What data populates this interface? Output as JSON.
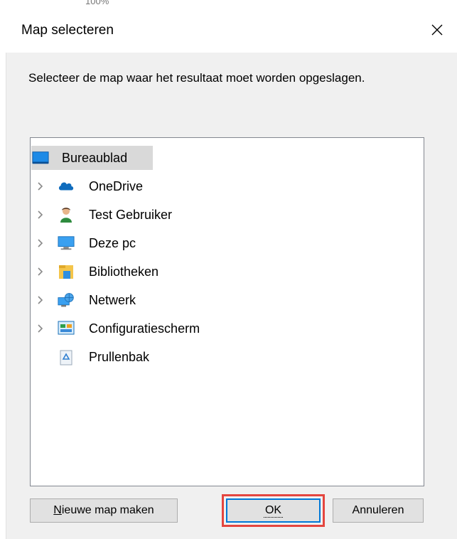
{
  "background": {
    "peek_text": "100%"
  },
  "dialog": {
    "title": "Map selecteren",
    "instruction": "Selecteer de map waar het resultaat moet worden opgeslagen."
  },
  "tree": {
    "root": {
      "label": "Bureaublad",
      "icon": "desktop-icon",
      "selected": true
    },
    "items": [
      {
        "label": "OneDrive",
        "icon": "onedrive-icon",
        "expandable": true
      },
      {
        "label": "Test Gebruiker",
        "icon": "user-icon",
        "expandable": true
      },
      {
        "label": "Deze pc",
        "icon": "computer-icon",
        "expandable": true
      },
      {
        "label": "Bibliotheken",
        "icon": "libraries-icon",
        "expandable": true
      },
      {
        "label": "Netwerk",
        "icon": "network-icon",
        "expandable": true
      },
      {
        "label": "Configuratiescherm",
        "icon": "control-panel-icon",
        "expandable": true
      },
      {
        "label": "Prullenbak",
        "icon": "recycle-bin-icon",
        "expandable": false
      }
    ]
  },
  "buttons": {
    "new_folder": "Nieuwe map maken",
    "new_folder_mnemonic": "N",
    "new_folder_rest": "ieuwe map maken",
    "ok": "OK",
    "cancel": "Annuleren"
  },
  "colors": {
    "highlight_border": "#e4463f",
    "focus_blue": "#0078d7",
    "selection": "#d9d9d9"
  }
}
